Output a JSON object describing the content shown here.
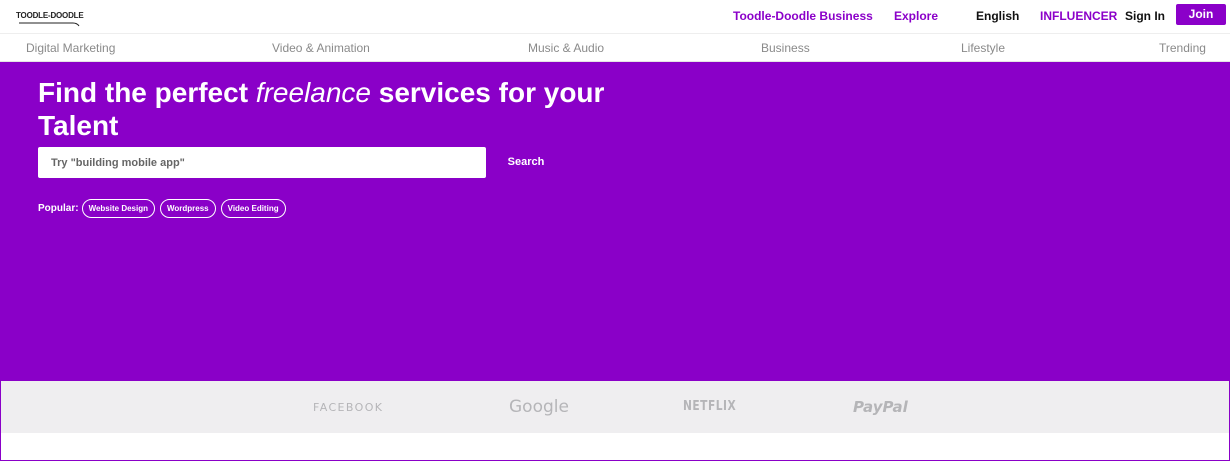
{
  "header": {
    "logo_text": "TOODLE-DOODLE",
    "links": {
      "business": "Toodle-Doodle Business",
      "explore": "Explore",
      "language": "English",
      "influencer": "INFLUENCER",
      "signin": "Sign In",
      "join": "Join"
    },
    "accent_color": "#8b00c9"
  },
  "categories": [
    "Digital Marketing",
    "Video & Animation",
    "Music & Audio",
    "Business",
    "Lifestyle",
    "Trending"
  ],
  "hero": {
    "title_before": "Find the perfect",
    "title_emphasis": "freelance",
    "title_after": "services for your Talent",
    "background_color": "#8a00c8",
    "search": {
      "placeholder": "Try \"building mobile app\"",
      "button_label": "Search"
    },
    "popular": {
      "label": "Popular:",
      "tags": [
        "Website Design",
        "Wordpress",
        "Video Editing"
      ]
    }
  },
  "trusted_by": {
    "brands": [
      "FACEBOOK",
      "Google",
      "NETFLIX",
      "PayPal"
    ]
  }
}
